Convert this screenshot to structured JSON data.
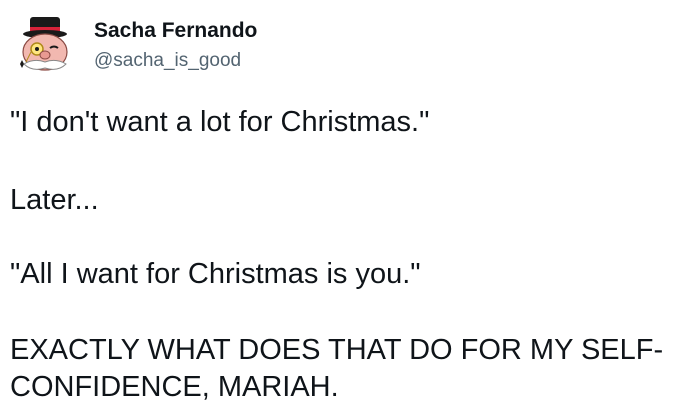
{
  "tweet": {
    "author": {
      "display_name": "Sacha Fernando",
      "handle": "@sacha_is_good",
      "avatar_icon": "cartoon-monopoly-man-avatar-icon"
    },
    "paragraphs": [
      "\"I don't want a lot for Christmas.\"",
      "Later...",
      "\"All I want for Christmas is you.\"",
      "EXACTLY WHAT DOES THAT DO FOR MY SELF-CONFIDENCE, MARIAH."
    ]
  },
  "colors": {
    "text": "#0f1419",
    "secondary_text": "#536471",
    "background": "#ffffff",
    "avatar_hat": "#1a1a1a",
    "avatar_band": "#d9233a",
    "avatar_face": "#f2b8b0"
  }
}
